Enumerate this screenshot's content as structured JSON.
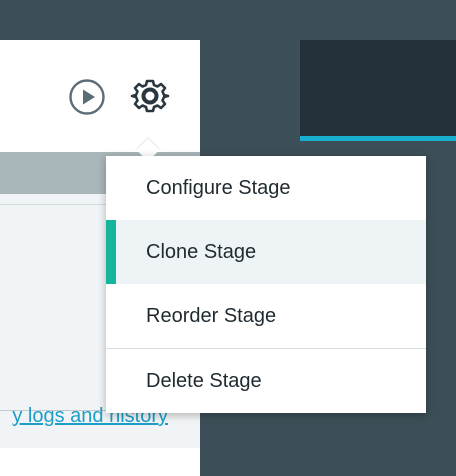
{
  "stage_card": {
    "history_link": "y logs and history"
  },
  "icons": {
    "play": "play-circle-icon",
    "gear": "gear-icon"
  },
  "dropdown": {
    "items": [
      {
        "label": "Configure Stage"
      },
      {
        "label": "Clone Stage"
      },
      {
        "label": "Reorder Stage"
      },
      {
        "label": "Delete Stage"
      }
    ],
    "active_item": "Clone Stage"
  },
  "colors": {
    "background": "#3c4e57",
    "dark_panel": "#25313a",
    "accent_blue": "#18aecf",
    "active_green": "#14b59a",
    "link": "#1e9ec6"
  }
}
